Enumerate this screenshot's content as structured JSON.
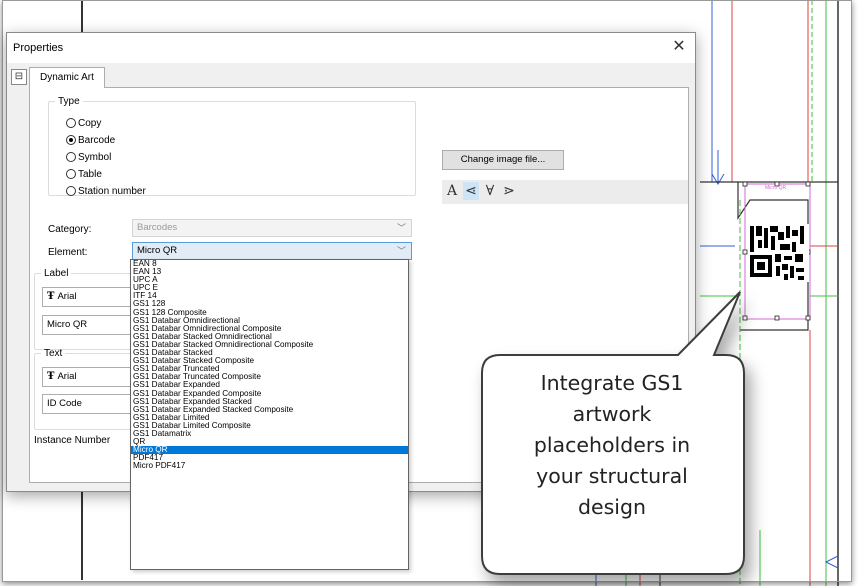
{
  "dialog": {
    "title": "Properties",
    "close_label": "✕",
    "tab_label": "Dynamic Art",
    "type_group": {
      "legend": "Type",
      "options": [
        {
          "label": "Copy",
          "checked": false
        },
        {
          "label": "Barcode",
          "checked": true
        },
        {
          "label": "Symbol",
          "checked": false
        },
        {
          "label": "Table",
          "checked": false
        },
        {
          "label": "Station number",
          "checked": false
        }
      ]
    },
    "category": {
      "label": "Category:",
      "value": "Barcodes"
    },
    "element": {
      "label": "Element:",
      "value": "Micro QR"
    },
    "label_group": {
      "legend": "Label",
      "font": "Arial",
      "text": "Micro QR"
    },
    "text_group": {
      "legend": "Text",
      "font": "Arial",
      "text": "ID Code"
    },
    "instance_number_label": "Instance Number",
    "change_image_button": "Change image file...",
    "text_style_icons": [
      "A",
      "⋖",
      "∀",
      "⋗"
    ],
    "dropdown_items": [
      "EAN 8",
      "EAN 13",
      "UPC A",
      "UPC E",
      "ITF 14",
      "GS1 128",
      "GS1 128 Composite",
      "GS1 Databar Omnidirectional",
      "GS1 Databar Omnidirectional Composite",
      "GS1 Databar Stacked Omnidirectional",
      "GS1 Databar Stacked Omnidirectional Composite",
      "GS1 Databar Stacked",
      "GS1 Databar Stacked Composite",
      "GS1 Databar Truncated",
      "GS1 Databar Truncated Composite",
      "GS1 Databar Expanded",
      "GS1 Databar Expanded Composite",
      "GS1 Databar Expanded Stacked",
      "GS1 Databar Expanded Stacked Composite",
      "GS1 Databar Limited",
      "GS1 Databar Limited Composite",
      "GS1 Datamatrix",
      "QR",
      "Micro QR",
      "PDF417",
      "Micro PDF417"
    ],
    "dropdown_selected": "Micro QR"
  },
  "canvas": {
    "barcode_caption": "Micro QR"
  },
  "callout": {
    "lines": [
      "Integrate GS1",
      "artwork",
      "placeholders in",
      "your structural",
      "design"
    ]
  },
  "colors": {
    "accent_blue": "#0078d7",
    "drawing_blue": "#2f5fd8",
    "drawing_green": "#3fbf3f",
    "drawing_red": "#d94040",
    "drawing_magenta": "#d36ad3",
    "active_combo_fill": "#e1ecf7"
  },
  "icons": {
    "close": "close-icon",
    "tab": "dynamic-art-tab-icon",
    "font": "truetype-font-icon",
    "dropdown": "chevron-down-icon"
  }
}
